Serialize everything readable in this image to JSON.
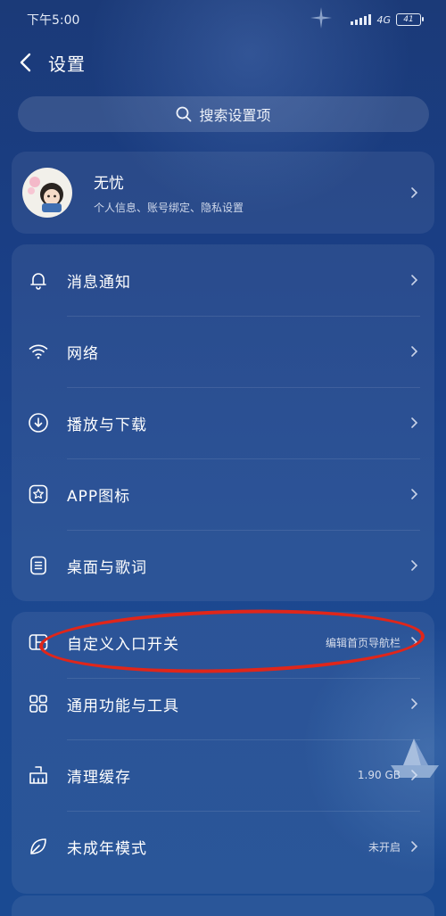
{
  "status_bar": {
    "time": "下午5:00",
    "network": "4G",
    "battery": "41"
  },
  "header": {
    "title": "设置"
  },
  "search": {
    "placeholder": "搜索设置项"
  },
  "profile": {
    "name": "无忧",
    "subtitle": "个人信息、账号绑定、隐私设置"
  },
  "group1": [
    {
      "label": "消息通知",
      "icon": "bell-icon"
    },
    {
      "label": "网络",
      "icon": "wifi-icon"
    },
    {
      "label": "播放与下载",
      "icon": "download-icon"
    },
    {
      "label": "APP图标",
      "icon": "app-icon-icon"
    },
    {
      "label": "桌面与歌词",
      "icon": "lyrics-icon"
    }
  ],
  "group2": [
    {
      "label": "自定义入口开关",
      "value": "编辑首页导航栏",
      "icon": "layout-icon"
    },
    {
      "label": "通用功能与工具",
      "value": "",
      "icon": "grid-icon"
    },
    {
      "label": "清理缓存",
      "value": "1.90 GB",
      "icon": "broom-icon"
    },
    {
      "label": "未成年模式",
      "value": "未开启",
      "icon": "leaf-icon"
    }
  ],
  "colors": {
    "background": "#1b3f86",
    "highlight_oval": "#e0261a"
  }
}
